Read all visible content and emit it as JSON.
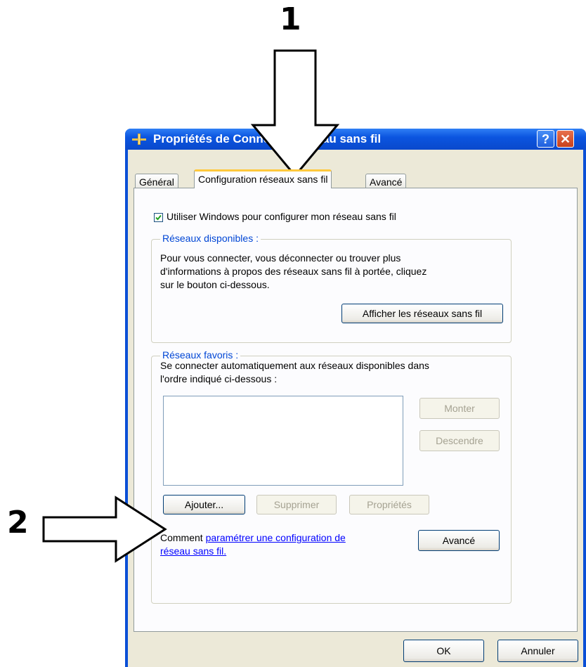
{
  "annotations": {
    "step1": "1",
    "step2": "2"
  },
  "window": {
    "title": "Propriétés de Connexion réseau sans fil",
    "help_label": "?",
    "close_label": "✕"
  },
  "tabs": [
    {
      "label": "Général"
    },
    {
      "label": "Configuration réseaux sans fil",
      "selected": true
    },
    {
      "label": "Avancé"
    }
  ],
  "config": {
    "use_windows_label": "Utiliser Windows pour configurer mon réseau sans fil",
    "use_windows_checked": true,
    "available": {
      "title": "Réseaux disponibles :",
      "desc_line1": "Pour vous connecter, vous déconnecter ou trouver plus",
      "desc_line2": "d'informations à propos des réseaux sans fil à portée, cliquez",
      "desc_line3": "sur le bouton ci-dessous.",
      "show_button": "Afficher les réseaux sans fil"
    },
    "preferred": {
      "title": "Réseaux favoris :",
      "desc_line1": "Se connecter automatiquement aux réseaux disponibles dans",
      "desc_line2": "l'ordre indiqué ci-dessous :",
      "up_button": "Monter",
      "down_button": "Descendre",
      "add_button": "Ajouter...",
      "remove_button": "Supprimer",
      "properties_button": "Propriétés",
      "help_prefix": "Comment ",
      "help_link_line1": "paramétrer une configuration de",
      "help_link_line2": "réseau sans fil.",
      "advanced_button": "Avancé"
    }
  },
  "footer": {
    "ok": "OK",
    "cancel": "Annuler"
  }
}
